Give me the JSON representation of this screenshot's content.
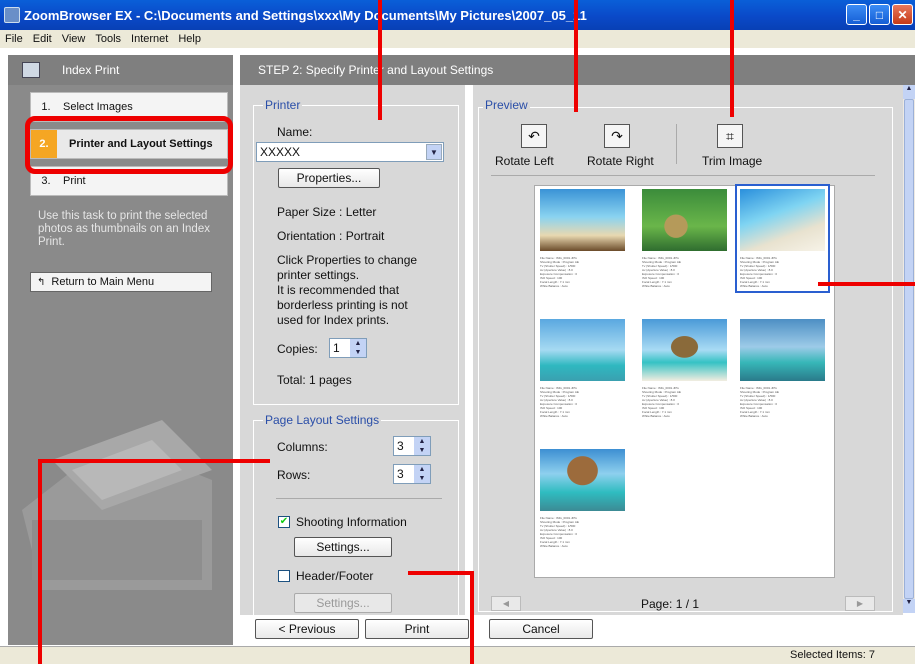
{
  "window": {
    "title": "ZoomBrowser EX  -  C:\\Documents and Settings\\xxx\\My Documents\\My Pictures\\2007_05_11"
  },
  "menu": [
    "File",
    "Edit",
    "View",
    "Tools",
    "Internet",
    "Help"
  ],
  "left": {
    "header": "Index Print",
    "steps": [
      {
        "num": "1.",
        "label": "Select Images"
      },
      {
        "num": "2.",
        "label": "Printer and Layout Settings"
      },
      {
        "num": "3.",
        "label": "Print"
      }
    ],
    "description": "Use this task to print the selected photos as thumbnails on an Index Print.",
    "return_label": "Return to Main Menu"
  },
  "main": {
    "header": "STEP 2: Specify Printer and Layout Settings",
    "printer": {
      "group_title": "Printer",
      "name_label": "Name:",
      "name_value": "XXXXX",
      "properties_label": "Properties...",
      "paper_size": "Paper Size : Letter",
      "orientation": "Orientation : Portrait",
      "help_text": "Click Properties to change printer settings.\nIt is recommended that borderless printing is not used for Index prints.",
      "copies_label": "Copies:",
      "copies_value": "1",
      "total": "Total: 1 pages"
    },
    "layout": {
      "group_title": "Page Layout Settings",
      "columns_label": "Columns:",
      "columns_value": "3",
      "rows_label": "Rows:",
      "rows_value": "3",
      "shooting_info_label": "Shooting Information",
      "shooting_info_checked": true,
      "settings_label": "Settings...",
      "header_footer_label": "Header/Footer",
      "header_footer_checked": false,
      "settings2_label": "Settings..."
    },
    "preview": {
      "group_title": "Preview",
      "rotate_left": "Rotate Left",
      "rotate_right": "Rotate Right",
      "trim": "Trim Image",
      "page": "Page: 1 / 1"
    },
    "buttons": {
      "previous": "< Previous",
      "print": "Print",
      "cancel": "Cancel"
    }
  },
  "status": {
    "selected": "Selected Items: 7"
  },
  "thumb_info": "File Name : IMG_0001.JPG\nShooting Mode : Program AE\nTv (Shutter Speed) : 1/500\nAv (Aperture Value) : 8.0\nExposure Compensation : 0\nISO Speed : 100\nFocal Length : 7.1 mm\nWhite Balance : Auto"
}
